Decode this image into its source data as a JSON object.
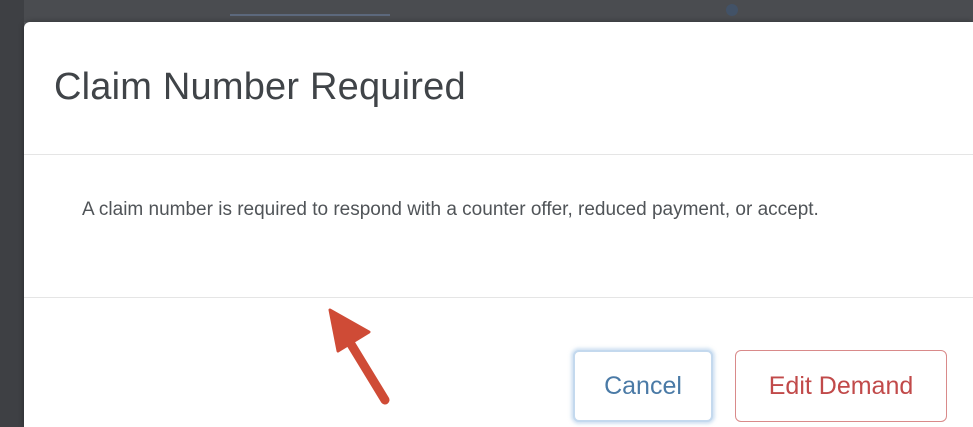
{
  "dialog": {
    "title": "Claim Number Required",
    "message": "A claim number is required to respond with a counter offer, reduced payment, or accept.",
    "buttons": {
      "cancel_label": "Cancel",
      "edit_demand_label": "Edit Demand"
    }
  },
  "colors": {
    "title_text": "#404448",
    "body_text": "#505458",
    "cancel_text": "#4a7aa6",
    "cancel_border": "#c4d9ee",
    "edit_text": "#c14a4a",
    "edit_border": "#d98a8a",
    "annotation_arrow": "#cf4b36",
    "backdrop": "#5a5d61"
  },
  "annotation": {
    "icon": "pointer-arrow-icon"
  }
}
